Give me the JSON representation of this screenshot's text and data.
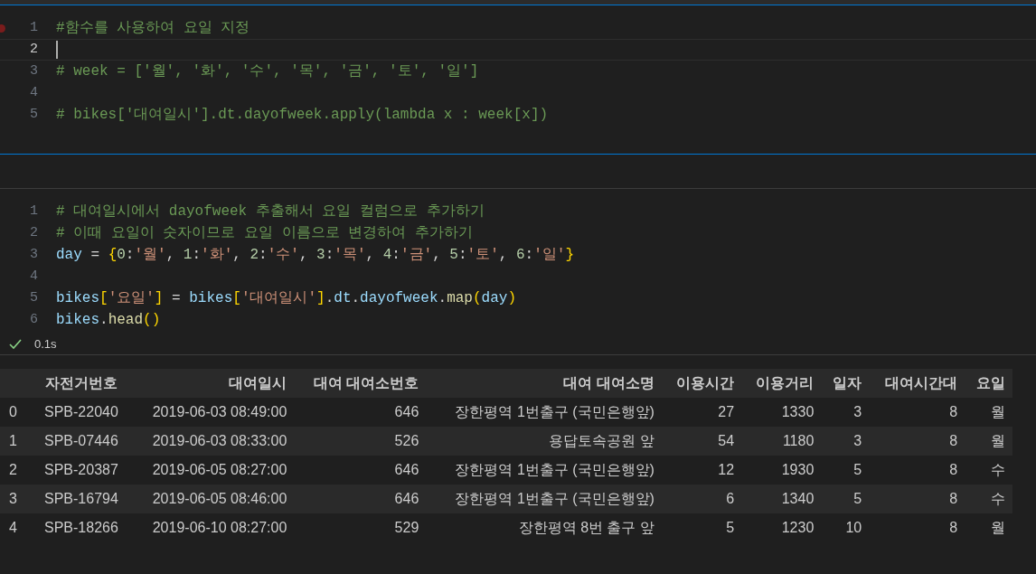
{
  "cells": [
    {
      "focused": true,
      "lines": [
        {
          "number": "1",
          "breakpoint": true,
          "current": false,
          "tokens": [
            {
              "kind": "comment",
              "text": "#함수를 사용하여 요일 지정"
            }
          ]
        },
        {
          "number": "2",
          "breakpoint": false,
          "current": true
        },
        {
          "number": "3",
          "breakpoint": false,
          "current": false,
          "tokens": [
            {
              "kind": "comment",
              "text": "# week = ['월', '화', '수', '목', '금', '토', '일']"
            }
          ]
        },
        {
          "number": "4",
          "breakpoint": false,
          "current": false
        },
        {
          "number": "5",
          "breakpoint": false,
          "current": false,
          "tokens": [
            {
              "kind": "comment",
              "text": "# bikes['대여일시'].dt.dayofweek.apply(lambda x : week[x])"
            }
          ]
        }
      ]
    },
    {
      "focused": false,
      "lines": [
        {
          "number": "1",
          "breakpoint": false,
          "current": false,
          "tokens": [
            {
              "kind": "comment",
              "text": "# 대여일시에서 dayofweek 추출해서 요일 컬럼으로 추가하기"
            }
          ]
        },
        {
          "number": "2",
          "breakpoint": false,
          "current": false,
          "tokens": [
            {
              "kind": "comment",
              "text": "# 이때 요일이 숫자이므로 요일 이름으로 변경하여 추가하기"
            }
          ]
        },
        {
          "number": "3",
          "breakpoint": false,
          "current": false,
          "tokens": [
            {
              "kind": "variable",
              "text": "day"
            },
            {
              "kind": "punct",
              "text": " = "
            },
            {
              "kind": "bracket",
              "text": "{"
            },
            {
              "kind": "number",
              "text": "0"
            },
            {
              "kind": "punct",
              "text": ":"
            },
            {
              "kind": "string",
              "text": "'월'"
            },
            {
              "kind": "punct",
              "text": ", "
            },
            {
              "kind": "number",
              "text": "1"
            },
            {
              "kind": "punct",
              "text": ":"
            },
            {
              "kind": "string",
              "text": "'화'"
            },
            {
              "kind": "punct",
              "text": ", "
            },
            {
              "kind": "number",
              "text": "2"
            },
            {
              "kind": "punct",
              "text": ":"
            },
            {
              "kind": "string",
              "text": "'수'"
            },
            {
              "kind": "punct",
              "text": ", "
            },
            {
              "kind": "number",
              "text": "3"
            },
            {
              "kind": "punct",
              "text": ":"
            },
            {
              "kind": "string",
              "text": "'목'"
            },
            {
              "kind": "punct",
              "text": ", "
            },
            {
              "kind": "number",
              "text": "4"
            },
            {
              "kind": "punct",
              "text": ":"
            },
            {
              "kind": "string",
              "text": "'금'"
            },
            {
              "kind": "punct",
              "text": ", "
            },
            {
              "kind": "number",
              "text": "5"
            },
            {
              "kind": "punct",
              "text": ":"
            },
            {
              "kind": "string",
              "text": "'토'"
            },
            {
              "kind": "punct",
              "text": ", "
            },
            {
              "kind": "number",
              "text": "6"
            },
            {
              "kind": "punct",
              "text": ":"
            },
            {
              "kind": "string",
              "text": "'일'"
            },
            {
              "kind": "bracket",
              "text": "}"
            }
          ]
        },
        {
          "number": "4",
          "breakpoint": false,
          "current": false
        },
        {
          "number": "5",
          "breakpoint": false,
          "current": false,
          "tokens": [
            {
              "kind": "variable",
              "text": "bikes"
            },
            {
              "kind": "bracket",
              "text": "["
            },
            {
              "kind": "string",
              "text": "'요일'"
            },
            {
              "kind": "bracket",
              "text": "]"
            },
            {
              "kind": "punct",
              "text": " = "
            },
            {
              "kind": "variable",
              "text": "bikes"
            },
            {
              "kind": "bracket",
              "text": "["
            },
            {
              "kind": "string",
              "text": "'대여일시'"
            },
            {
              "kind": "bracket",
              "text": "]"
            },
            {
              "kind": "punct",
              "text": "."
            },
            {
              "kind": "variable",
              "text": "dt"
            },
            {
              "kind": "punct",
              "text": "."
            },
            {
              "kind": "variable",
              "text": "dayofweek"
            },
            {
              "kind": "punct",
              "text": "."
            },
            {
              "kind": "function",
              "text": "map"
            },
            {
              "kind": "bracket",
              "text": "("
            },
            {
              "kind": "variable",
              "text": "day"
            },
            {
              "kind": "bracket",
              "text": ")"
            }
          ]
        },
        {
          "number": "6",
          "breakpoint": false,
          "current": false,
          "tokens": [
            {
              "kind": "variable",
              "text": "bikes"
            },
            {
              "kind": "punct",
              "text": "."
            },
            {
              "kind": "function",
              "text": "head"
            },
            {
              "kind": "bracket",
              "text": "()"
            }
          ]
        }
      ],
      "status": {
        "success": true,
        "duration": "0.1s"
      },
      "output": {
        "columns": [
          "자전거번호",
          "대여일시",
          "대여 대여소번호",
          "대여 대여소명",
          "이용시간",
          "이용거리",
          "일자",
          "대여시간대",
          "요일"
        ],
        "rows": [
          {
            "index": "0",
            "cells": [
              "SPB-22040",
              "2019-06-03 08:49:00",
              "646",
              "장한평역 1번출구 (국민은행앞)",
              "27",
              "1330",
              "3",
              "8",
              "월"
            ]
          },
          {
            "index": "1",
            "cells": [
              "SPB-07446",
              "2019-06-03 08:33:00",
              "526",
              "용답토속공원 앞",
              "54",
              "1180",
              "3",
              "8",
              "월"
            ]
          },
          {
            "index": "2",
            "cells": [
              "SPB-20387",
              "2019-06-05 08:27:00",
              "646",
              "장한평역 1번출구 (국민은행앞)",
              "12",
              "1930",
              "5",
              "8",
              "수"
            ]
          },
          {
            "index": "3",
            "cells": [
              "SPB-16794",
              "2019-06-05 08:46:00",
              "646",
              "장한평역 1번출구 (국민은행앞)",
              "6",
              "1340",
              "5",
              "8",
              "수"
            ]
          },
          {
            "index": "4",
            "cells": [
              "SPB-18266",
              "2019-06-10 08:27:00",
              "529",
              "장한평역 8번 출구 앞",
              "5",
              "1230",
              "10",
              "8",
              "월"
            ]
          }
        ]
      }
    }
  ]
}
